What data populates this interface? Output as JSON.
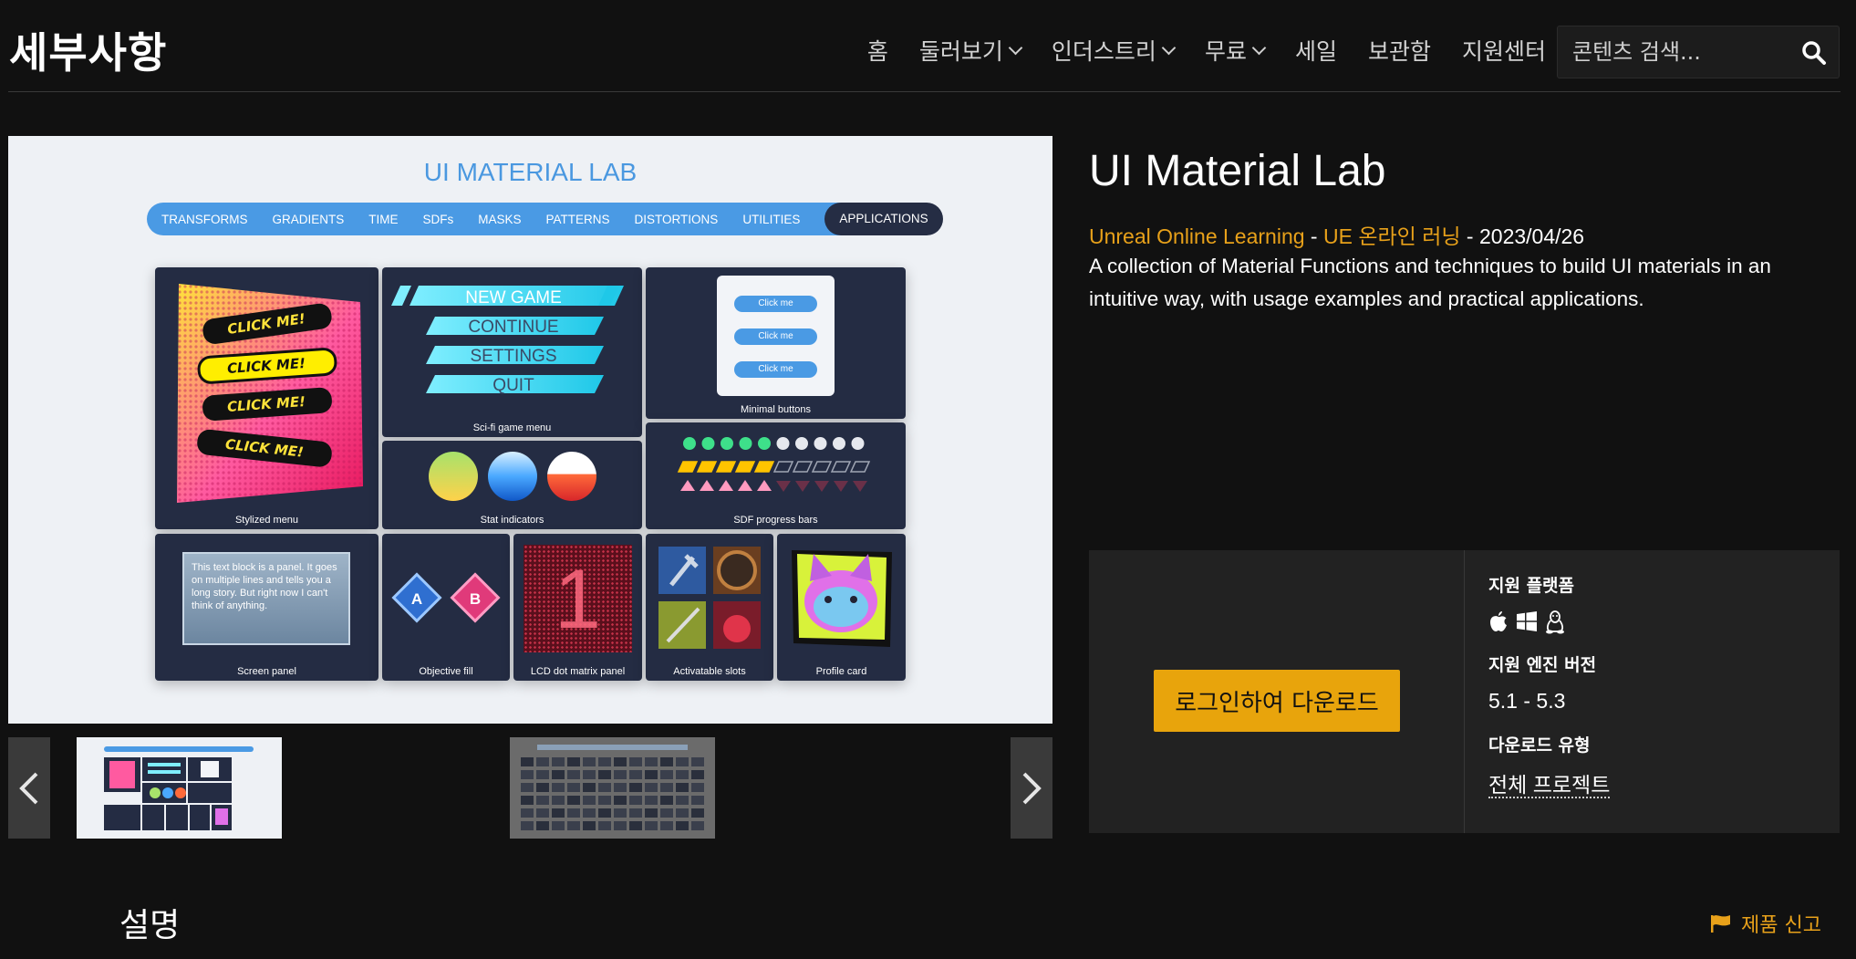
{
  "header": {
    "logo": "세부사항",
    "nav": [
      {
        "label": "홈",
        "dropdown": false
      },
      {
        "label": "둘러보기",
        "dropdown": true
      },
      {
        "label": "인더스트리",
        "dropdown": true
      },
      {
        "label": "무료",
        "dropdown": true
      },
      {
        "label": "세일",
        "dropdown": false
      },
      {
        "label": "보관함",
        "dropdown": false
      },
      {
        "label": "지원센터",
        "dropdown": false
      }
    ],
    "search_placeholder": "콘텐츠 검색..."
  },
  "preview": {
    "title": "UI MATERIAL LAB",
    "tabs": [
      "TRANSFORMS",
      "GRADIENTS",
      "TIME",
      "SDFs",
      "MASKS",
      "PATTERNS",
      "DISTORTIONS",
      "UTILITIES",
      "APPLICATIONS"
    ],
    "active_tab": "APPLICATIONS",
    "click_me_stylized": [
      "CLICK ME!",
      "CLICK ME!",
      "CLICK ME!",
      "CLICK ME!"
    ],
    "scifi_menu": [
      "NEW GAME",
      "CONTINUE",
      "SETTINGS",
      "QUIT"
    ],
    "minimal_buttons": [
      "Click me",
      "Click me",
      "Click me"
    ],
    "panel_text": "This text block is a panel. It goes on multiple lines and tells you a long story. But right now I can't think of anything.",
    "objective_letters": [
      "A",
      "B"
    ],
    "lcd_digit": "1",
    "captions": {
      "stylized_menu": "Stylized menu",
      "scifi_game_menu": "Sci-fi game menu",
      "minimal_buttons": "Minimal buttons",
      "stat_indicators": "Stat indicators",
      "sdf_progress_bars": "SDF progress bars",
      "screen_panel": "Screen panel",
      "objective_fill": "Objective fill",
      "lcd_dot_matrix_panel": "LCD dot matrix panel",
      "activatable_slots": "Activatable slots",
      "profile_card": "Profile card"
    },
    "sdf_progress": {
      "dots_filled": 5,
      "dots_total": 10,
      "bars_filled": 5,
      "bars_total": 10,
      "triangles_filled": 5,
      "triangles_total": 10
    }
  },
  "product": {
    "title": "UI Material Lab",
    "seller": "Unreal Online Learning",
    "seller_alt": "UE 온라인 러닝",
    "separator": " - ",
    "date": "2023/04/26",
    "description": "A collection of Material Functions and techniques to build UI materials in an intuitive way, with usage examples and practical applications."
  },
  "download": {
    "button_label": "로그인하여 다운로드",
    "platforms_label": "지원 플랫폼",
    "platform_icons": [
      "apple-icon",
      "windows-icon",
      "linux-icon"
    ],
    "engine_label": "지원 엔진 버전",
    "engine_value": "5.1 - 5.3",
    "type_label": "다운로드 유형",
    "type_value": "전체 프로젝트"
  },
  "footer": {
    "section_title": "설명",
    "report_label": "제품 신고"
  },
  "colors": {
    "accent": "#e8a11a",
    "background": "#111111",
    "tab_blue": "#4a9ae4",
    "card_navy": "#242c43"
  }
}
